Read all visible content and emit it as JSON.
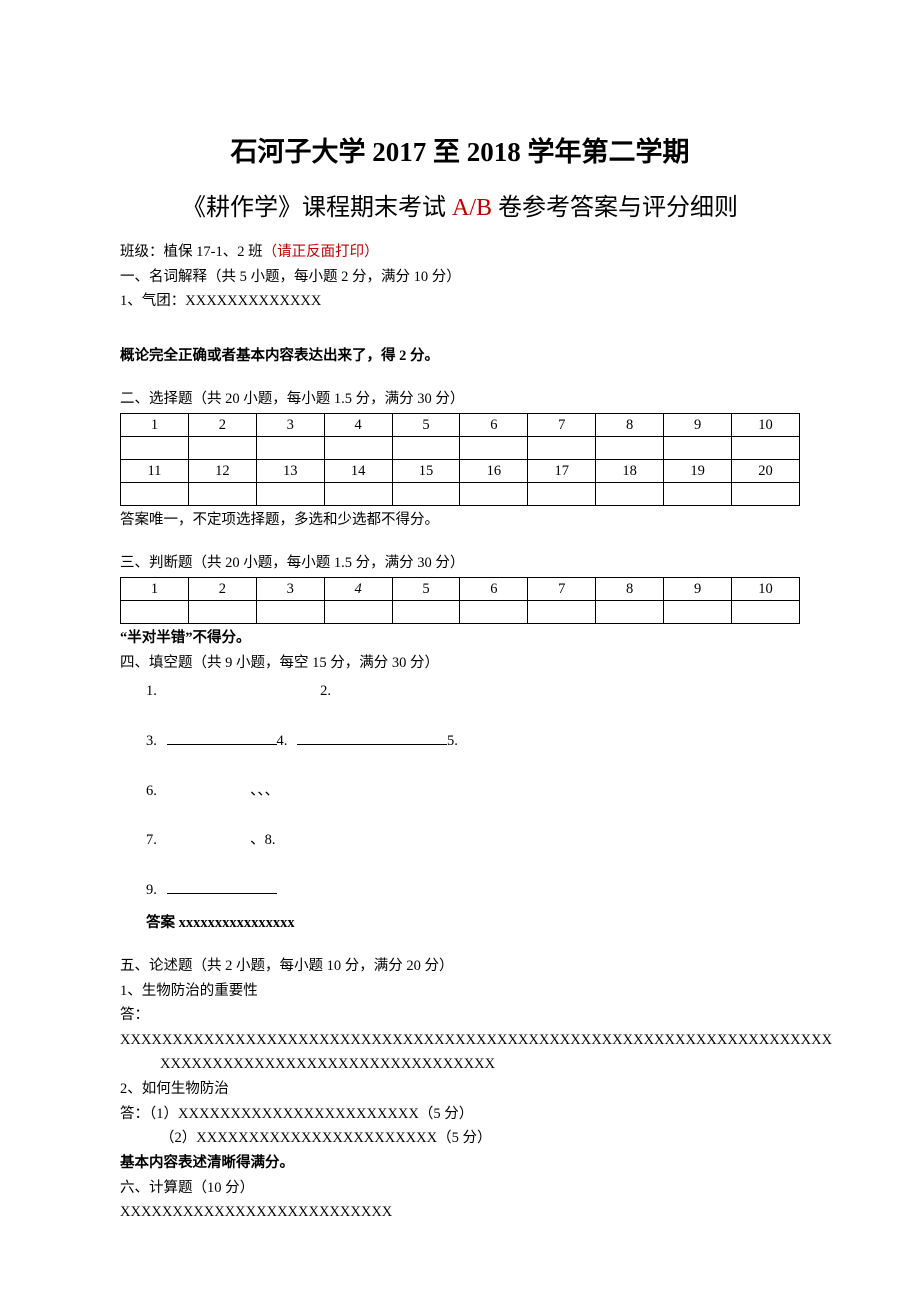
{
  "header": {
    "title1": "石河子大学 2017 至 2018 学年第二学期",
    "title2_pre": "《耕作学》课程期末考试 ",
    "title2_ab": "A/B",
    "title2_post": " 卷参考答案与评分细则"
  },
  "class_line_pre": "班级：植保 17-1、2 班",
  "class_line_red": "（请正反面打印）",
  "s1": {
    "heading": "一、名词解释（共 5 小题，每小题 2 分，满分 10 分）",
    "item1": "1、气团：XXXXXXXXXXXXX",
    "note": "概论完全正确或者基本内容表达出来了，得 2 分。"
  },
  "s2": {
    "heading": "二、选择题（共 20 小题，每小题 1.5 分，满分 30 分）",
    "row1": [
      "1",
      "2",
      "3",
      "4",
      "5",
      "6",
      "7",
      "8",
      "9",
      "10"
    ],
    "row2": [
      "",
      "",
      "",
      "",
      "",
      "",
      "",
      "",
      "",
      ""
    ],
    "row3": [
      "11",
      "12",
      "13",
      "14",
      "15",
      "16",
      "17",
      "18",
      "19",
      "20"
    ],
    "row4": [
      "",
      "",
      "",
      "",
      "",
      "",
      "",
      "",
      "",
      ""
    ],
    "note": "答案唯一，不定项选择题，多选和少选都不得分。"
  },
  "s3": {
    "heading": "三、判断题（共 20 小题，每小题 1.5 分，满分 30 分）",
    "row1": [
      "1",
      "2",
      "3",
      "4",
      "5",
      "6",
      "7",
      "8",
      "9",
      "10"
    ],
    "row2": [
      "",
      "",
      "",
      "",
      "",
      "",
      "",
      "",
      "",
      ""
    ],
    "note": "“半对半错”不得分。"
  },
  "s4": {
    "heading": "四、填空题（共 9 小题，每空 15 分，满分 30 分）",
    "n1": "1.",
    "n2": "2.",
    "n3": "3. ",
    "n4": "4. ",
    "n5": "5.",
    "n6": "6.",
    "n6_tail": "、、、",
    "n7": "7.",
    "n8": "、8.",
    "n9": "9. ",
    "ans": "答案 xxxxxxxxxxxxxxxx"
  },
  "s5": {
    "heading": "五、论述题（共 2 小题，每小题 10 分，满分 20 分）",
    "q1": "1、生物防治的重要性",
    "a1_line1": "答：XXXXXXXXXXXXXXXXXXXXXXXXXXXXXXXXXXXXXXXXXXXXXXXXXXXXXXXXXXXXXXXXXXXX",
    "a1_line2": "XXXXXXXXXXXXXXXXXXXXXXXXXXXXXXXX",
    "q2": "2、如何生物防治",
    "a2_line1": "答：（1）XXXXXXXXXXXXXXXXXXXXXXX（5 分）",
    "a2_line2": "（2）XXXXXXXXXXXXXXXXXXXXXXX（5 分）",
    "note": "基本内容表述清晰得满分。"
  },
  "s6": {
    "heading": "六、计算题（10 分）",
    "body": "XXXXXXXXXXXXXXXXXXXXXXXXXX"
  }
}
